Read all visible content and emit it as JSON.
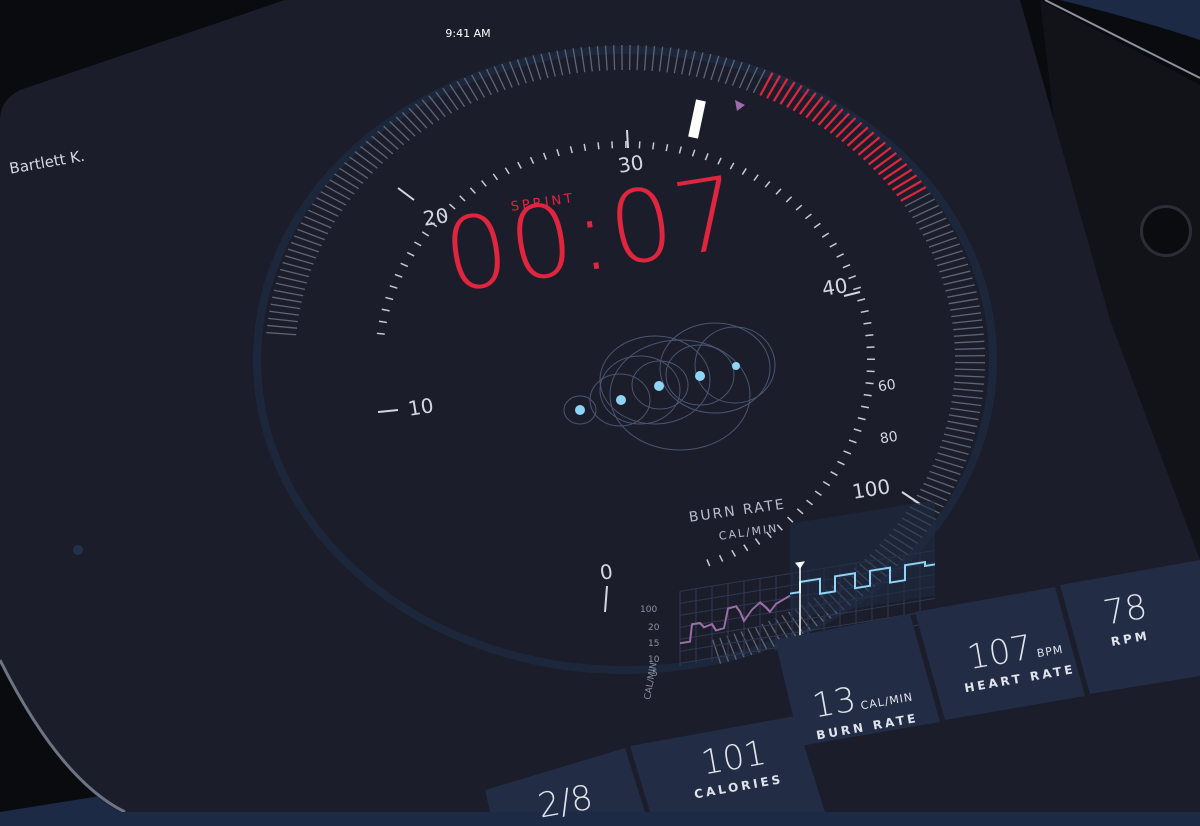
{
  "status_bar": {
    "time": "9:41 AM"
  },
  "user": {
    "name": "Bartlett K."
  },
  "workout": {
    "phase_label": "SPRINT",
    "timer": "00:07"
  },
  "dial": {
    "labels": [
      "0",
      "10",
      "20",
      "30",
      "40",
      "60",
      "80",
      "100"
    ]
  },
  "burn_chart": {
    "title": "BURN RATE",
    "unit": "CAL/MIN",
    "y_ticks": [
      "100",
      "20",
      "15",
      "10",
      "5"
    ],
    "axis_label": "CAL/MIN"
  },
  "stats": [
    {
      "value": "101",
      "unit": "",
      "label": "CALORIES"
    },
    {
      "value": "13",
      "unit": "CAL/MIN",
      "label": "BURN RATE"
    },
    {
      "value": "107",
      "unit": "BPM",
      "label": "HEART RATE"
    },
    {
      "value": "78",
      "unit": "",
      "label": "RPM"
    }
  ],
  "partial_tile": {
    "value": "2/8"
  },
  "colors": {
    "accent": "#e0263f",
    "screen_bg": "#1b1d2b",
    "tile_bg": "#202b42",
    "cyan": "#8fd3f5",
    "purple": "#9b6ea8"
  },
  "icons": [
    "home-button-icon",
    "camera-icon",
    "marker-triangle-icon"
  ]
}
